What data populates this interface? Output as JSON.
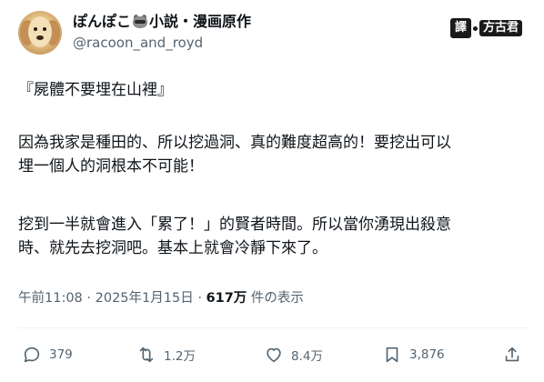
{
  "tweet": {
    "author": {
      "display_name_before_icon": "ぽんぽこ",
      "display_name_after_icon": "小説・漫画原作",
      "display_icon": "raccoon-icon",
      "handle": "@racoon_and_royd"
    },
    "watermark": {
      "box_char": "譯",
      "text": "方古君"
    },
    "lines": {
      "p1_l1": "『屍體不要埋在山裡』",
      "p2_l1": "因為我家是種田的、所以挖過洞、真的難度超高的！要挖出可以",
      "p2_l2": "埋一個人的洞根本不可能！",
      "p3_l1": "挖到一半就會進入「累了！」的賢者時間。所以當你湧現出殺意",
      "p3_l2": "時、就先去挖洞吧。基本上就會冷靜下來了。"
    },
    "meta": {
      "time": "午前11:08",
      "separator1": "·",
      "date": "2025年1月15日",
      "separator2": "·",
      "views_count": "617万",
      "views_label": "件の表示"
    },
    "actions": {
      "replies": "379",
      "retweets": "1.2万",
      "likes": "8.4万",
      "bookmarks": "3,876"
    }
  }
}
